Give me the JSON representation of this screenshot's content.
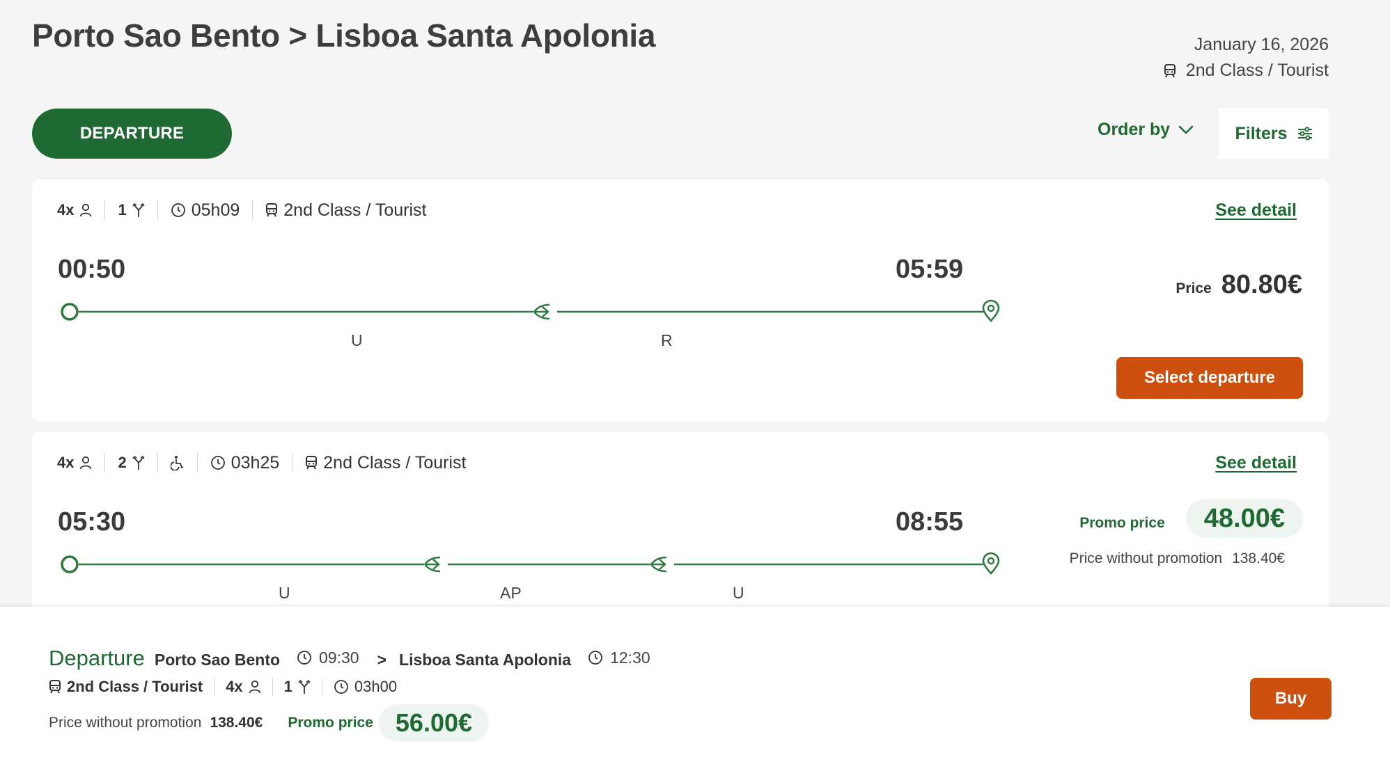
{
  "header": {
    "title": "Porto Sao Bento > Lisboa Santa Apolonia",
    "date": "January 16, 2026",
    "class": "2nd Class / Tourist"
  },
  "toolbar": {
    "departure_tab": "DEPARTURE",
    "order_by": "Order by",
    "filters": "Filters"
  },
  "results": [
    {
      "passengers": "4x",
      "changes": "1",
      "duration": "05h09",
      "class": "2nd Class / Tourist",
      "see_detail": "See detail",
      "departure_time": "00:50",
      "arrival_time": "05:59",
      "segments": [
        "U",
        "R"
      ],
      "price_label": "Price",
      "price": "80.80€",
      "select_label": "Select departure"
    },
    {
      "passengers": "4x",
      "changes": "2",
      "duration": "03h25",
      "class": "2nd Class / Tourist",
      "see_detail": "See detail",
      "departure_time": "05:30",
      "arrival_time": "08:55",
      "segments": [
        "U",
        "AP",
        "U"
      ],
      "promo_label": "Promo price",
      "promo_price": "48.00€",
      "without_promo_label": "Price without promotion",
      "without_promo_price": "138.40€"
    }
  ],
  "summary": {
    "title": "Departure",
    "origin": "Porto Sao Bento",
    "departure_time": "09:30",
    "separator": ">",
    "destination": "Lisboa Santa Apolonia",
    "arrival_time": "12:30",
    "class": "2nd Class / Tourist",
    "passengers": "4x",
    "changes": "1",
    "duration": "03h00",
    "without_promo_label": "Price without promotion",
    "without_promo_price": "138.40€",
    "promo_label": "Promo price",
    "promo_price": "56.00€",
    "buy_label": "Buy"
  },
  "colors": {
    "brand_green": "#1e6a32",
    "accent_orange": "#cc4f0e",
    "promo_bg": "#eef4ef"
  }
}
